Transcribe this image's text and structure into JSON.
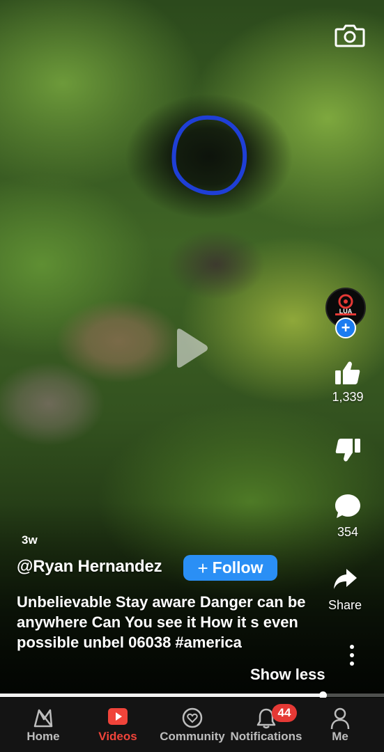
{
  "post": {
    "age": "3w",
    "channel": "@Ryan Hernandez",
    "follow_label": "Follow",
    "description": "Unbelievable Stay aware Danger can be anywhere Can You see it How it s even possible unbel 06038 #america",
    "show_less": "Show less",
    "progress_fraction": 0.84
  },
  "actions": {
    "likes": "1,339",
    "comments": "354",
    "share_label": "Share"
  },
  "avatar": {
    "logo_text": "LUA"
  },
  "nav": {
    "items": [
      {
        "label": "Home",
        "icon": "home-icon"
      },
      {
        "label": "Videos",
        "icon": "videos-play-icon"
      },
      {
        "label": "Community",
        "icon": "community-heart-icon"
      },
      {
        "label": "Notifications",
        "icon": "bell-icon"
      },
      {
        "label": "Me",
        "icon": "person-icon"
      }
    ],
    "notification_count": "44",
    "active_index": 1
  },
  "colors": {
    "accent_red": "#f0443a",
    "follow_blue": "#2a8ff5",
    "badge_red": "#e53935",
    "annotation_blue": "#1f3fd6"
  }
}
